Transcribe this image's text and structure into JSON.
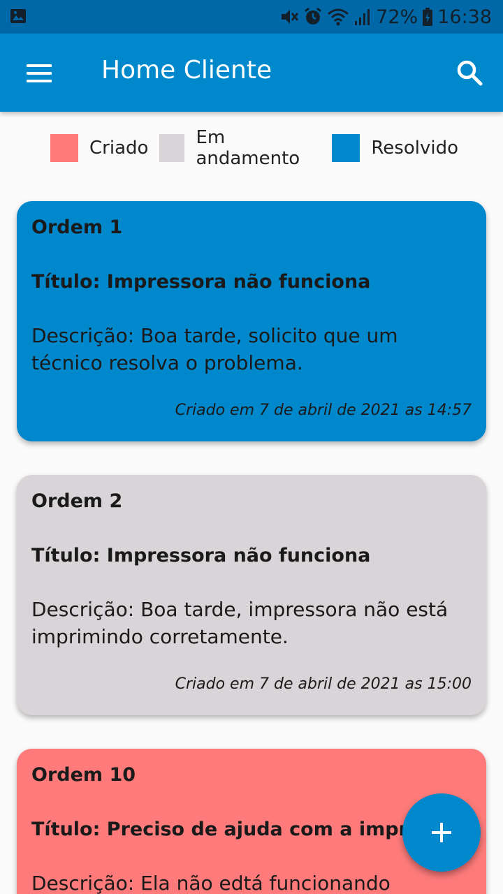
{
  "status_bar": {
    "battery": "72%",
    "time": "16:38"
  },
  "app_bar": {
    "title": "Home Cliente"
  },
  "legend": [
    {
      "label": "Criado",
      "color": "#ff7b7b"
    },
    {
      "label": "Em andamento",
      "color": "#d8d4d8"
    },
    {
      "label": "Resolvido",
      "color": "#0088cc"
    }
  ],
  "orders": [
    {
      "order": "Ordem 1",
      "title": "Título: Impressora não funciona",
      "description": "Descrição: Boa tarde, solicito que um técnico resolva o problema.",
      "created": "Criado em 7 de abril de 2021 as 14:57",
      "status": "Resolvido",
      "color": "#0088cc"
    },
    {
      "order": "Ordem 2",
      "title": "Título: Impressora não funciona",
      "description": "Descrição: Boa tarde, impressora não está imprimindo corretamente.",
      "created": "Criado em 7 de abril de 2021 as 15:00",
      "status": "Em andamento",
      "color": "#d8d4d8"
    },
    {
      "order": "Ordem 10",
      "title": "Título: Preciso de ajuda com a impressora",
      "description": "Descrição: Ela não edtá funcionando",
      "created": "",
      "status": "Criado",
      "color": "#ff7b7b"
    }
  ],
  "fab": {
    "icon": "plus-icon"
  }
}
